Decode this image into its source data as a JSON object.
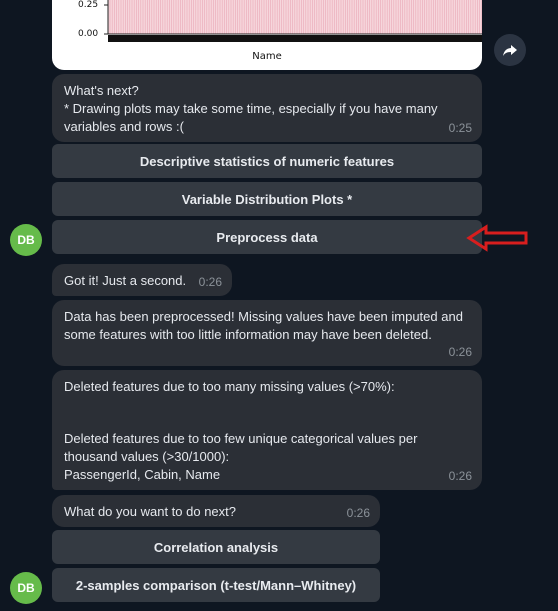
{
  "chart": {
    "ytick_top": "0.25",
    "ytick_bottom": "0.00",
    "xlabel": "Name"
  },
  "share_icon": "share-icon",
  "messages": {
    "whats_next_1": {
      "text": "What's next?\n * Drawing plots may take some time, especially if you have many variables and rows :(",
      "time": "0:25"
    },
    "got_it": {
      "text": "Got it! Just a second.",
      "time": "0:26"
    },
    "preprocessed": {
      "text": "Data has been preprocessed! Missing values have been imputed and some features with too little information may have been deleted.",
      "time": "0:26"
    },
    "deleted": {
      "line1": "Deleted features due to too many missing values (>70%):",
      "line2": " Deleted features due to too few unique categorical values per thousand values (>30/1000):",
      "line3": "PassengerId, Cabin, Name",
      "time": "0:26"
    },
    "whats_next_2": {
      "text": "What do you want to do next?",
      "time": "0:26"
    }
  },
  "buttons": {
    "descriptive": "Descriptive statistics of numeric features",
    "distribution": "Variable Distribution Plots *",
    "preprocess": "Preprocess data",
    "correlation": "Correlation analysis",
    "two_sample": "2-samples comparison (t-test/Mann–Whitney)"
  },
  "avatar_initials": "DB",
  "colors": {
    "background": "#0e1621",
    "bubble": "#2b2f36",
    "keyboard_button": "#343a42",
    "avatar": "#66bb4a",
    "annotation_arrow": "#d81e1e"
  }
}
